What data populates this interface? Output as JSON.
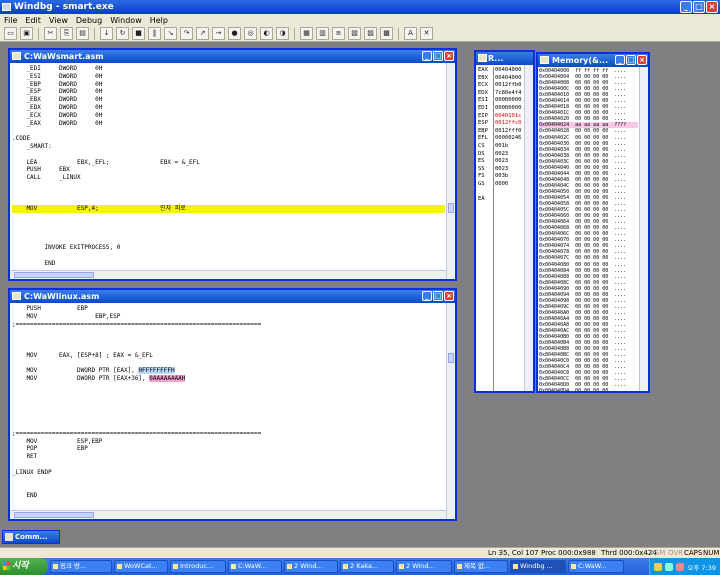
{
  "app": {
    "title": "Windbg - smart.exe"
  },
  "menu": [
    "File",
    "Edit",
    "View",
    "Debug",
    "Window",
    "Help"
  ],
  "toolbar_icons": [
    "open-icon",
    "save-icon",
    "cut-icon",
    "copy-icon",
    "paste-icon",
    "go-icon",
    "restart-icon",
    "stop-icon",
    "break-icon",
    "step-into-icon",
    "step-over-icon",
    "step-out-icon",
    "run-to-cursor-icon",
    "breakpoint-icon",
    "quickwatch-icon",
    "watch-icon",
    "locals-icon",
    "registers-icon",
    "memory-icon",
    "callstack-icon",
    "disassembly-icon",
    "scratch-icon",
    "source-mode-icon",
    "font-icon",
    "options-icon"
  ],
  "asm_window": {
    "title": "C:WaWsmart.asm",
    "lines": [
      "    _EDI     DWORD     0H",
      "    _ESI     DWORD     0H",
      "    _EBP     DWORD     0H",
      "    _ESP     DWORD     0H",
      "    _EBX     DWORD     0H",
      "    _EDX     DWORD     0H",
      "    _ECX     DWORD     0H",
      "    _EAX     DWORD     0H",
      "",
      ".CODE",
      "    _SMART:",
      "",
      "    LEA           EBX,_EFL;              EBX = &_EFL",
      "    PUSH     EBX",
      "    CALL     _LINUX",
      "",
      "",
      "",
      "    MOV           ESP,4;                 인자 피로",
      "",
      "",
      "",
      "",
      "         INVOKE EXITPROCESS, 0",
      "",
      "         END"
    ],
    "highlight_line": 18
  },
  "linux_window": {
    "title": "C:WaWlinux.asm",
    "lines": [
      "    PUSH          EBP",
      "    MOV                EBP,ESP",
      ";====================================================================",
      "",
      "",
      "",
      "    MOV      EAX, [ESP+8] ; EAX = &_EFL",
      "",
      "    MOV           DWORD PTR [EAX], 0FFFFFFFFH",
      "    MOV           DWORD PTR [EAX+36], 0AAAAAAAAH",
      "",
      "",
      "",
      "",
      "",
      "",
      ";====================================================================",
      "    MOV           ESP,EBP",
      "    POP           EBP",
      "    RET",
      "",
      "_LINUX ENDP",
      "",
      "",
      "    END"
    ],
    "hl_blue": "0FFFFFFFFH",
    "hl_pink": "0AAAAAAAAH"
  },
  "registers_window": {
    "title": "R...",
    "names": [
      "EAX",
      "EBX",
      "ECX",
      "EDX",
      "ESI",
      "EDI",
      "EIP",
      "ESP",
      "EBP",
      "EFL",
      "CS",
      "DS",
      "ES",
      "SS",
      "FS",
      "GS",
      "",
      "EA"
    ],
    "values": [
      "00404000",
      "00404000",
      "0012ffb0",
      "7c80e4f4",
      "00000000",
      "00000000",
      "0040101c",
      "0012ffc0",
      "0012fff0",
      "00000246",
      "001b",
      "0023",
      "0023",
      "0023",
      "003b",
      "0000",
      "",
      ""
    ],
    "changed_indices": [
      6,
      7
    ]
  },
  "memory_window": {
    "title": "Memory(&...",
    "lines": [
      "0x00404000  ff ff ff ff  ....",
      "0x00404004  00 00 00 00  ....",
      "0x00404008  00 00 00 00  ....",
      "0x0040400C  00 00 00 00  ....",
      "0x00404010  00 00 00 00  ....",
      "0x00404014  00 00 00 00  ....",
      "0x00404018  00 00 00 00  ....",
      "0x0040401C  00 00 00 00  ....",
      "0x00404020  00 00 00 00  ....",
      "0x00404024  aa aa aa aa  ????",
      "0x00404028  00 00 00 00  ....",
      "0x0040402C  00 00 00 00  ....",
      "0x00404030  00 00 00 00  ....",
      "0x00404034  00 00 00 00  ....",
      "0x00404038  00 00 00 00  ....",
      "0x0040403C  00 00 00 00  ....",
      "0x00404040  00 00 00 00  ....",
      "0x00404044  00 00 00 00  ....",
      "0x00404048  00 00 00 00  ....",
      "0x0040404C  00 00 00 00  ....",
      "0x00404050  00 00 00 00  ....",
      "0x00404054  00 00 00 00  ....",
      "0x00404058  00 00 00 00  ....",
      "0x0040405C  00 00 00 00  ....",
      "0x00404060  00 00 00 00  ....",
      "0x00404064  00 00 00 00  ....",
      "0x00404068  00 00 00 00  ....",
      "0x0040406C  00 00 00 00  ....",
      "0x00404070  00 00 00 00  ....",
      "0x00404074  00 00 00 00  ....",
      "0x00404078  00 00 00 00  ....",
      "0x0040407C  00 00 00 00  ....",
      "0x00404080  00 00 00 00  ....",
      "0x00404084  00 00 00 00  ....",
      "0x00404088  00 00 00 00  ....",
      "0x0040408C  00 00 00 00  ....",
      "0x00404090  00 00 00 00  ....",
      "0x00404094  00 00 00 00  ....",
      "0x00404098  00 00 00 00  ....",
      "0x0040409C  00 00 00 00  ....",
      "0x004040A0  00 00 00 00  ....",
      "0x004040A4  00 00 00 00  ....",
      "0x004040A8  00 00 00 00  ....",
      "0x004040AC  00 00 00 00  ....",
      "0x004040B0  00 00 00 00  ....",
      "0x004040B4  00 00 00 00  ....",
      "0x004040B8  00 00 00 00  ....",
      "0x004040BC  00 00 00 00  ....",
      "0x004040C0  00 00 00 00  ....",
      "0x004040C4  00 00 00 00  ....",
      "0x004040C8  00 00 00 00  ....",
      "0x004040CC  00 00 00 00  ....",
      "0x004040D0  00 00 00 00  ....",
      "0x004040D4  00 00 00 00  ....",
      "0x004040D8  00 00 00 00  ....",
      "0x004040DC  00 00 00 00  ....",
      "0x004040E0  00 00 00 00  ...."
    ]
  },
  "command_window": {
    "title": "Comm..."
  },
  "statusbar": {
    "pos": "Ln 35, Col 107",
    "proc": "Proc 000:0x988",
    "thrd": "Thrd 000:0x424",
    "asm": "ASM",
    "ovr": "OVR",
    "caps": "CAPS",
    "num": "NUM"
  },
  "taskbar": {
    "start": "시작",
    "buttons": [
      "링크 방...",
      "WoWCat...",
      "Introduc...",
      "C:WaW...",
      "2 Wind...",
      "2 Kaka...",
      "2 Wind...",
      "제목 없...",
      "Windbg ...",
      "C:WaW..."
    ],
    "clock": "오후 7:39"
  },
  "colors": {
    "highlight_yellow": "#f4f40a",
    "value_blue_bg": "#bcd8f8",
    "value_pink_bg": "#f4a0d0",
    "changed_red": "#e00000",
    "title_blue": "#0b4ac6"
  }
}
